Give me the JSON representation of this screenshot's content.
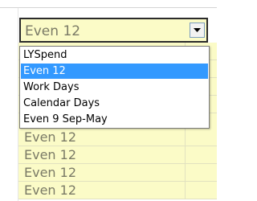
{
  "combo": {
    "value": "Even 12"
  },
  "dropdown": {
    "options": [
      "LYSpend",
      "Even 12",
      "Work Days",
      "Calendar Days",
      "Even 9 Sep-May"
    ],
    "selected": "Even 12"
  },
  "grid": {
    "rows": [
      "Even 12",
      "Even 12",
      "Even 12",
      "Even 12"
    ]
  },
  "colors": {
    "cell_background": "#fbfbc7",
    "selection": "#3399ff",
    "border": "#2b2b2b"
  },
  "icons": {
    "dropdown_arrow": "chevron-down-icon"
  }
}
